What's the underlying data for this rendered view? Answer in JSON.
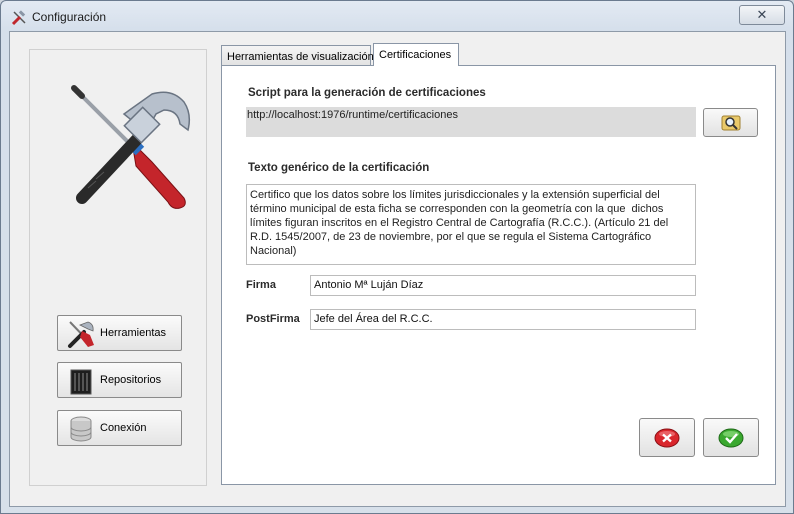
{
  "window": {
    "title": "Configuración",
    "close_glyph": "✕"
  },
  "nav": [
    {
      "label": "Herramientas",
      "icon": "tools-icon"
    },
    {
      "label": "Repositorios",
      "icon": "server-icon"
    },
    {
      "label": "Conexión",
      "icon": "database-icon"
    }
  ],
  "tabs": [
    {
      "label": "Herramientas de visualización",
      "active": false
    },
    {
      "label": "Certificaciones",
      "active": true
    }
  ],
  "cert": {
    "script_label": "Script para la generación de certificaciones",
    "script_value": "http://localhost:1976/runtime/certificaciones",
    "text_label": "Texto genérico de la certificación",
    "text_value": "Certifico que los datos sobre los límites jurisdiccionales y la extensión superficial del término municipal de esta ficha se corresponden con la geometría con la que  dichos límites figuran inscritos en el Registro Central de Cartografía (R.C.C.). (Artículo 21 del R.D. 1545/2007, de 23 de noviembre, por el que se regula el Sistema Cartográfico Nacional)",
    "firma_label": "Firma",
    "firma_value": "Antonio Mª Luján Díaz",
    "postfirma_label": "PostFirma",
    "postfirma_value": "Jefe del Área del R.C.C."
  },
  "colors": {
    "cancel": "#d9262c",
    "accept": "#3aa82f"
  }
}
